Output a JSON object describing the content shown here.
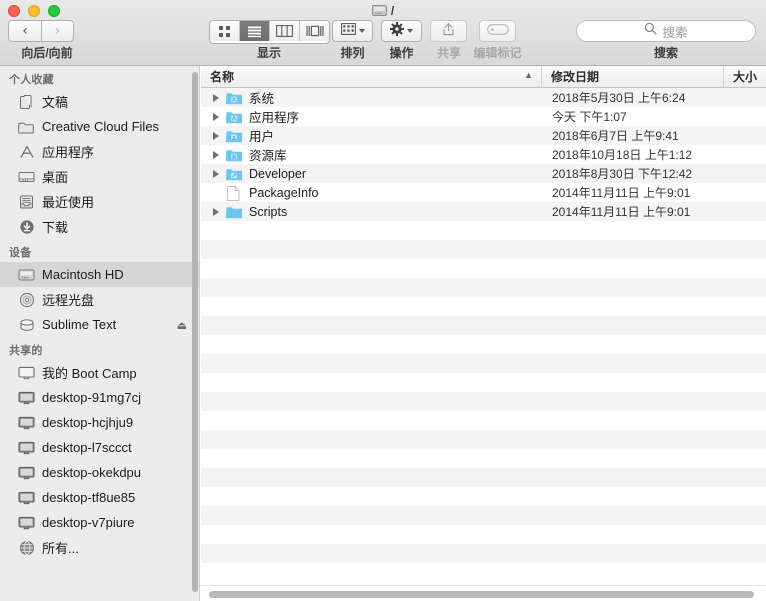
{
  "window": {
    "title": "/",
    "disk_icon": "hard-disk-icon",
    "controls": [
      "close",
      "minimize",
      "zoom"
    ]
  },
  "toolbar": {
    "nav": {
      "back": "back-arrow",
      "forward": "forward-arrow",
      "label": "向后/向前"
    },
    "view": {
      "label": "显示",
      "modes": [
        {
          "name": "icon-view",
          "active": false
        },
        {
          "name": "list-view",
          "active": true
        },
        {
          "name": "column-view",
          "active": false
        },
        {
          "name": "gallery-view",
          "active": false
        }
      ]
    },
    "arrange": {
      "label": "排列",
      "icon": "grid-icon"
    },
    "action": {
      "label": "操作",
      "icon": "gear-icon"
    },
    "share": {
      "label": "共享",
      "icon": "share-icon"
    },
    "tags": {
      "label": "编辑标记",
      "icon": "tag-icon"
    },
    "search": {
      "placeholder": "搜索",
      "label": "搜索",
      "icon": "search-icon",
      "value": ""
    }
  },
  "sidebar": {
    "sections": [
      {
        "header": "个人收藏",
        "items": [
          {
            "label": "文稿",
            "icon": "documents-icon",
            "selected": false,
            "eject": false
          },
          {
            "label": "Creative Cloud Files",
            "icon": "folder-icon",
            "selected": false,
            "eject": false
          },
          {
            "label": "应用程序",
            "icon": "applications-icon",
            "selected": false,
            "eject": false
          },
          {
            "label": "桌面",
            "icon": "desktop-icon",
            "selected": false,
            "eject": false
          },
          {
            "label": "最近使用",
            "icon": "recents-icon",
            "selected": false,
            "eject": false
          },
          {
            "label": "下载",
            "icon": "downloads-icon",
            "selected": false,
            "eject": false
          }
        ]
      },
      {
        "header": "设备",
        "items": [
          {
            "label": "Macintosh HD",
            "icon": "hard-disk-icon",
            "selected": true,
            "eject": false
          },
          {
            "label": "远程光盘",
            "icon": "optical-disc-icon",
            "selected": false,
            "eject": false
          },
          {
            "label": "Sublime Text",
            "icon": "disk-image-icon",
            "selected": false,
            "eject": true
          }
        ]
      },
      {
        "header": "共享的",
        "items": [
          {
            "label": "我的 Boot Camp",
            "icon": "display-icon",
            "selected": false,
            "eject": false
          },
          {
            "label": "desktop-91mg7cj",
            "icon": "computer-icon",
            "selected": false,
            "eject": false
          },
          {
            "label": "desktop-hcjhju9",
            "icon": "computer-icon",
            "selected": false,
            "eject": false
          },
          {
            "label": "desktop-l7sccct",
            "icon": "computer-icon",
            "selected": false,
            "eject": false
          },
          {
            "label": "desktop-okekdpu",
            "icon": "computer-icon",
            "selected": false,
            "eject": false
          },
          {
            "label": "desktop-tf8ue85",
            "icon": "computer-icon",
            "selected": false,
            "eject": false
          },
          {
            "label": "desktop-v7piure",
            "icon": "computer-icon",
            "selected": false,
            "eject": false
          },
          {
            "label": "所有...",
            "icon": "network-globe-icon",
            "selected": false,
            "eject": false
          }
        ]
      }
    ]
  },
  "file_list": {
    "columns": [
      {
        "label": "名称",
        "sorted": true,
        "sort_direction": "ascending"
      },
      {
        "label": "修改日期",
        "sorted": false
      },
      {
        "label": "大小",
        "sorted": false
      }
    ],
    "rows": [
      {
        "name": "系统",
        "icon": "folder-system-icon",
        "date": "2018年5月30日 上午6:24",
        "size": "",
        "expandable": true
      },
      {
        "name": "应用程序",
        "icon": "folder-applications-icon",
        "date": "今天 下午1:07",
        "size": "",
        "expandable": true
      },
      {
        "name": "用户",
        "icon": "folder-users-icon",
        "date": "2018年6月7日 上午9:41",
        "size": "",
        "expandable": true
      },
      {
        "name": "资源库",
        "icon": "folder-library-icon",
        "date": "2018年10月18日 上午1:12",
        "size": "",
        "expandable": true
      },
      {
        "name": "Developer",
        "icon": "folder-developer-icon",
        "date": "2018年8月30日 下午12:42",
        "size": "",
        "expandable": true
      },
      {
        "name": "PackageInfo",
        "icon": "document-icon",
        "date": "2014年11月11日 上午9:01",
        "size": "",
        "expandable": false
      },
      {
        "name": "Scripts",
        "icon": "folder-icon",
        "date": "2014年11月11日 上午9:01",
        "size": "",
        "expandable": true
      }
    ]
  },
  "colors": {
    "folder_blue": "#6cc6f0",
    "selection_gray": "#d5d5d5",
    "stripe_gray": "#f4f4f4",
    "toolbar_gray": "#e3e3e3"
  }
}
